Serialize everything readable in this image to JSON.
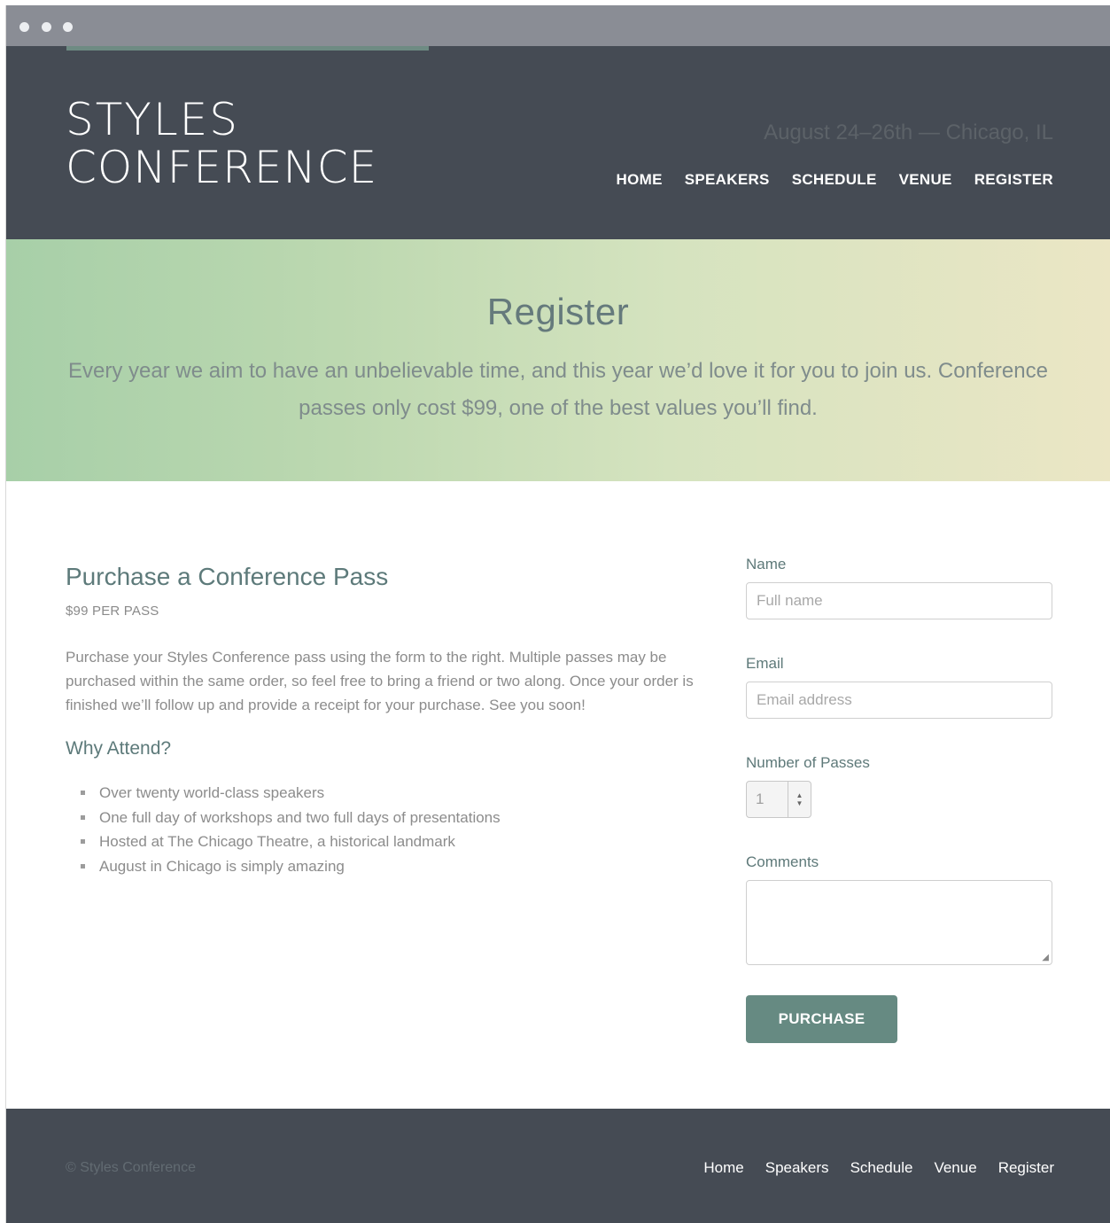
{
  "window": {
    "dots": [
      "dot",
      "dot",
      "dot"
    ]
  },
  "header": {
    "logo_line1": "STYLES",
    "logo_line2": "CONFERENCE",
    "tagline": "August 24–26th — Chicago, IL",
    "nav": [
      "HOME",
      "SPEAKERS",
      "SCHEDULE",
      "VENUE",
      "REGISTER"
    ]
  },
  "hero": {
    "title": "Register",
    "text": "Every year we aim to have an unbelievable time, and this year we’d love it for you to join us. Conference passes only cost $99, one of the best values you’ll find."
  },
  "main": {
    "heading": "Purchase a Conference Pass",
    "price": "$99 PER PASS",
    "description": "Purchase your Styles Conference pass using the form to the right. Multiple passes may be purchased within the same order, so feel free to bring a friend or two along. Once your order is finished we’ll follow up and provide a receipt for your purchase. See you soon!",
    "why_heading": "Why Attend?",
    "reasons": [
      "Over twenty world-class speakers",
      "One full day of workshops and two full days of presentations",
      "Hosted at The Chicago Theatre, a historical landmark",
      "August in Chicago is simply amazing"
    ]
  },
  "form": {
    "name_label": "Name",
    "name_placeholder": "Full name",
    "email_label": "Email",
    "email_placeholder": "Email address",
    "passes_label": "Number of Passes",
    "passes_value": "1",
    "comments_label": "Comments",
    "submit_label": "PURCHASE"
  },
  "footer": {
    "copyright": "© Styles Conference",
    "nav": [
      "Home",
      "Speakers",
      "Schedule",
      "Venue",
      "Register"
    ]
  },
  "colors": {
    "header_bg": "#454b54",
    "accent": "#668a82",
    "hero_start": "#a7cfa8",
    "hero_end": "#ebe6c5"
  }
}
